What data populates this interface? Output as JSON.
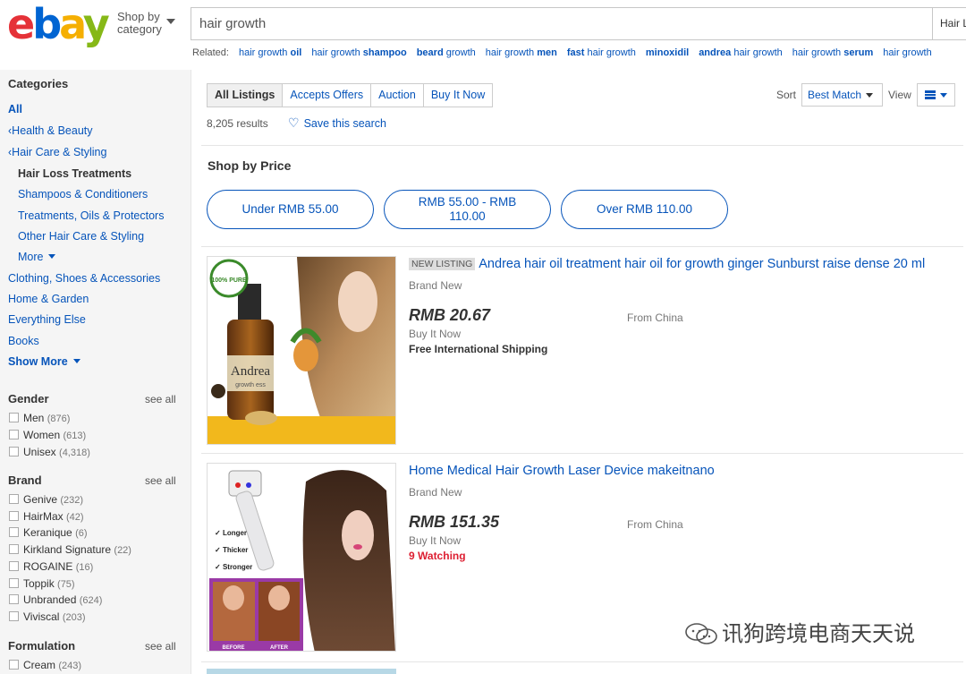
{
  "header": {
    "logo": {
      "e": "e",
      "b": "b",
      "a": "a",
      "y": "y"
    },
    "shop_by_line1": "Shop by",
    "shop_by_line2": "category",
    "search_value": "hair growth",
    "search_category": "Hair L"
  },
  "related": {
    "label": "Related:",
    "items": [
      {
        "pre": "hair growth ",
        "bold": "oil",
        "post": ""
      },
      {
        "pre": "hair growth ",
        "bold": "shampoo",
        "post": ""
      },
      {
        "pre": "",
        "bold": "beard",
        "post": " growth"
      },
      {
        "pre": "hair growth ",
        "bold": "men",
        "post": ""
      },
      {
        "pre": "",
        "bold": "fast",
        "post": " hair growth"
      },
      {
        "pre": "",
        "bold": "minoxidil",
        "post": ""
      },
      {
        "pre": "",
        "bold": "andrea",
        "post": " hair growth"
      },
      {
        "pre": "hair growth ",
        "bold": "serum",
        "post": ""
      },
      {
        "pre": "hair growth ",
        "bold": "",
        "post": ""
      }
    ]
  },
  "sidebar": {
    "categories_title": "Categories",
    "all": "All",
    "health_beauty": "Health & Beauty",
    "hair_care": "Hair Care & Styling",
    "hair_loss": "Hair Loss Treatments",
    "shampoos": "Shampoos & Conditioners",
    "treatments": "Treatments, Oils & Protectors",
    "other_hair": "Other Hair Care & Styling",
    "more": "More",
    "clothing": "Clothing, Shoes & Accessories",
    "home_garden": "Home & Garden",
    "everything_else": "Everything Else",
    "books": "Books",
    "show_more": "Show More",
    "see_all": "see all",
    "gender_title": "Gender",
    "gender": [
      {
        "label": "Men",
        "count": "(876)"
      },
      {
        "label": "Women",
        "count": "(613)"
      },
      {
        "label": "Unisex",
        "count": "(4,318)"
      }
    ],
    "brand_title": "Brand",
    "brand": [
      {
        "label": "Genive",
        "count": "(232)"
      },
      {
        "label": "HairMax",
        "count": "(42)"
      },
      {
        "label": "Keranique",
        "count": "(6)"
      },
      {
        "label": "Kirkland Signature",
        "count": "(22)"
      },
      {
        "label": "ROGAINE",
        "count": "(16)"
      },
      {
        "label": "Toppik",
        "count": "(75)"
      },
      {
        "label": "Unbranded",
        "count": "(624)"
      },
      {
        "label": "Viviscal",
        "count": "(203)"
      }
    ],
    "formulation_title": "Formulation",
    "formulation": [
      {
        "label": "Cream",
        "count": "(243)"
      }
    ]
  },
  "toolbar": {
    "tabs": [
      "All Listings",
      "Accepts Offers",
      "Auction",
      "Buy It Now"
    ],
    "sort_label": "Sort",
    "sort_value": "Best Match",
    "view_label": "View",
    "results": "8,205 results",
    "save_search": "Save this search"
  },
  "shop_by_price": {
    "title": "Shop by Price",
    "ranges": [
      "Under RMB 55.00",
      "RMB 55.00 - RMB 110.00",
      "Over RMB 110.00"
    ]
  },
  "items": [
    {
      "badge": "NEW LISTING",
      "title": "Andrea hair oil treatment hair oil for growth ginger Sunburst raise dense 20 ml",
      "condition": "Brand New",
      "price": "RMB 20.67",
      "from": "From China",
      "format": "Buy It Now",
      "shipping": "Free International Shipping",
      "image": {
        "bottle_text": "Andrea",
        "bottle_sub": "growth ess",
        "seal": "100% PURE"
      }
    },
    {
      "title": "Home Medical Hair Growth Laser Device makeitnano",
      "condition": "Brand New",
      "price": "RMB 151.35",
      "from": "From China",
      "format": "Buy It Now",
      "watching": "9 Watching",
      "image": {
        "feature1": "Longer",
        "feature2": "Thicker",
        "feature3": "Stronger",
        "before": "BEFORE",
        "after": "AFTER"
      }
    }
  ],
  "watermark": "讯狗跨境电商天天说",
  "colors": {
    "link": "#0654ba",
    "watching": "#dd1e31",
    "logo_e": "#e53238",
    "logo_b": "#0064d2",
    "logo_a": "#f5af02",
    "logo_y": "#86b817"
  }
}
